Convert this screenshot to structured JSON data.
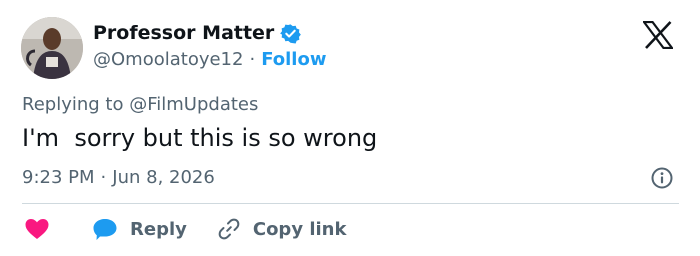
{
  "author": {
    "display_name": "Professor Matter",
    "handle": "@Omoolatoye12",
    "separator": "·",
    "follow_label": "Follow"
  },
  "reply_context": {
    "prefix": "Replying to",
    "mention": "@FilmUpdates"
  },
  "tweet": {
    "text": "I'm  sorry but this is so wrong",
    "time": "9:23 PM",
    "separator": "·",
    "date": "Jun 8, 2026"
  },
  "actions": {
    "reply_label": "Reply",
    "copy_link_label": "Copy link"
  },
  "icons": {
    "verified": "verified-badge-icon",
    "logo": "x-logo-icon",
    "info": "info-icon",
    "like": "heart-icon",
    "reply": "speech-bubble-icon",
    "copy": "link-icon"
  },
  "colors": {
    "accent": "#1d9bf0",
    "like": "#f91880",
    "text": "#0f1419",
    "muted": "#536471",
    "divider": "#cfd9de"
  }
}
